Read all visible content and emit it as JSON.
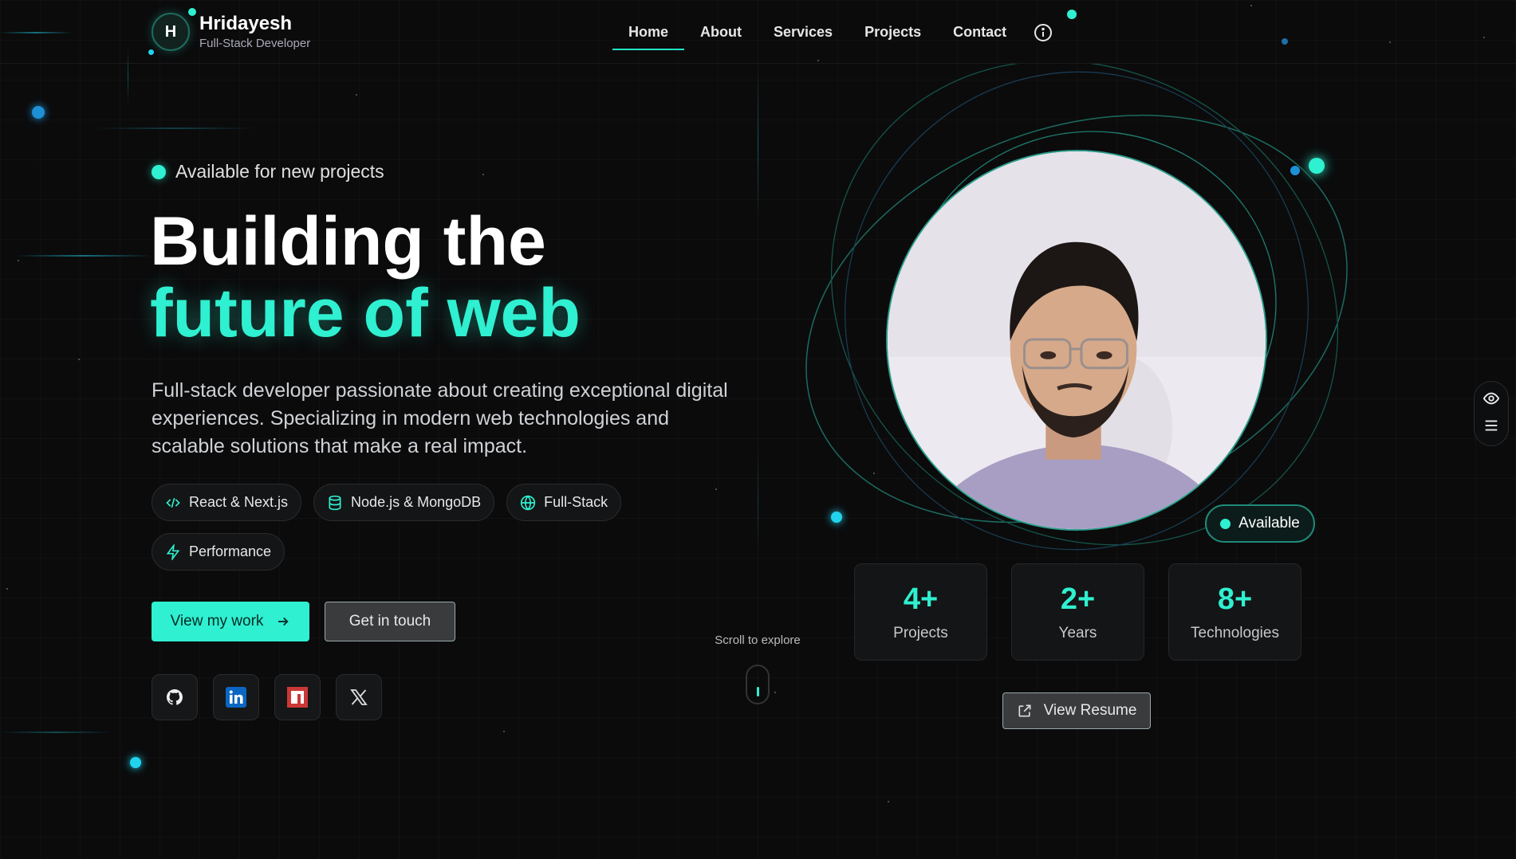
{
  "brand": {
    "initial": "H",
    "name": "Hridayesh",
    "role": "Full-Stack Developer"
  },
  "nav": {
    "items": [
      {
        "label": "Home",
        "active": true
      },
      {
        "label": "About",
        "active": false
      },
      {
        "label": "Services",
        "active": false
      },
      {
        "label": "Projects",
        "active": false
      },
      {
        "label": "Contact",
        "active": false
      }
    ],
    "info_icon": "info-circle-icon"
  },
  "hero": {
    "availability": "Available for new projects",
    "headline_line1": "Building the",
    "headline_line2": "future of web",
    "intro": "Full-stack developer passionate about creating exceptional digital experiences. Specializing in modern web technologies and scalable solutions that make a real impact.",
    "chips": [
      {
        "label": "React & Next.js",
        "icon": "code-icon"
      },
      {
        "label": "Node.js & MongoDB",
        "icon": "database-icon"
      },
      {
        "label": "Full-Stack",
        "icon": "globe-icon"
      },
      {
        "label": "Performance",
        "icon": "lightning-icon"
      }
    ],
    "primary_button": "View my work",
    "secondary_button": "Get in touch",
    "socials": [
      {
        "name": "github-icon"
      },
      {
        "name": "linkedin-icon"
      },
      {
        "name": "npm-icon"
      },
      {
        "name": "x-icon"
      }
    ],
    "scroll_hint": "Scroll to explore"
  },
  "profile": {
    "available_badge": "Available",
    "stats": [
      {
        "value": "4+",
        "label": "Projects"
      },
      {
        "value": "2+",
        "label": "Years"
      },
      {
        "value": "8+",
        "label": "Technologies"
      }
    ],
    "resume_button": "View Resume"
  },
  "side_tools": {
    "icons": [
      "eye-icon",
      "menu-icon"
    ]
  },
  "colors": {
    "accent": "#2ff0d0",
    "background": "#0b0b0c"
  }
}
